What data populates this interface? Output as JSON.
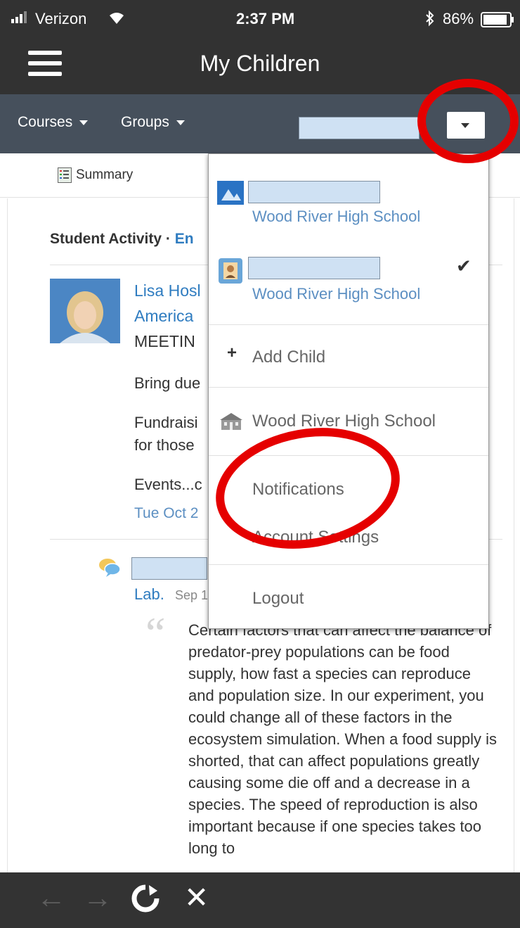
{
  "status_bar": {
    "carrier": "Verizon",
    "time": "2:37 PM",
    "battery": "86%",
    "icons": [
      "signal-icon",
      "wifi-icon",
      "bluetooth-icon",
      "battery-icon"
    ]
  },
  "header": {
    "title": "My Children"
  },
  "subnav": {
    "courses_label": "Courses",
    "groups_label": "Groups"
  },
  "tabs": {
    "summary_label": "Summary"
  },
  "activity": {
    "section_title": "Student Activity ·",
    "section_link": "En",
    "post": {
      "author_partial": "Lisa Hosl",
      "course_partial": "America",
      "title_partial": "MEETIN",
      "line1": "Bring due",
      "line2": "Fundraisi",
      "line3": "for those",
      "line4": "Events...c",
      "date_partial": "Tue Oct 2"
    },
    "comment": {
      "lab_label": "Lab.",
      "date_partial": "Sep 1",
      "quote_text": "Certain factors that can affect the balance of predator-prey populations can be food supply, how fast a species can reproduce and population size. In our experiment, you could change all of these factors in the ecosystem simulation. When a food supply is shorted, that can affect populations greatly causing some die off and a decrease in a species. The speed of reproduction is also important because if one species takes too long to"
    }
  },
  "menu": {
    "child1_school": "Wood River High School",
    "child2_school": "Wood River High School",
    "add_child": "Add Child",
    "school_link": "Wood River High School",
    "notifications": "Notifications",
    "account_settings": "Account Settings",
    "logout": "Logout"
  },
  "colors": {
    "header_bg": "#323232",
    "subnav_bg": "#46505c",
    "link": "#2f7cc0",
    "annotation": "#e50000",
    "redaction": "#cfe1f3"
  }
}
